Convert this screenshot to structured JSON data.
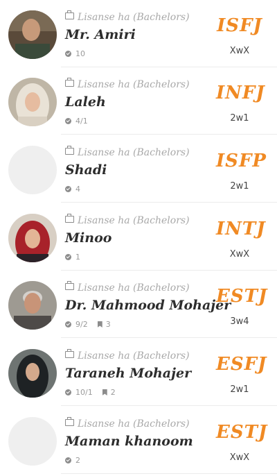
{
  "colors": {
    "accent": "#f08a24",
    "text": "#2d2d2d",
    "muted": "#a8a8a8"
  },
  "characters": [
    {
      "category": "Lisanse ha (Bachelors)",
      "name": "Mr. Amiri",
      "count": "10",
      "saves": "",
      "mbti": "ISFJ",
      "enneagram": "XwX",
      "avatar": "photo"
    },
    {
      "category": "Lisanse ha (Bachelors)",
      "name": "Laleh",
      "count": "4/1",
      "saves": "",
      "mbti": "INFJ",
      "enneagram": "2w1",
      "avatar": "photo"
    },
    {
      "category": "Lisanse ha (Bachelors)",
      "name": "Shadi",
      "count": "4",
      "saves": "",
      "mbti": "ISFP",
      "enneagram": "2w1",
      "avatar": "blank"
    },
    {
      "category": "Lisanse ha (Bachelors)",
      "name": "Minoo",
      "count": "1",
      "saves": "",
      "mbti": "INTJ",
      "enneagram": "XwX",
      "avatar": "photo"
    },
    {
      "category": "Lisanse ha (Bachelors)",
      "name": "Dr. Mahmood Mohajer",
      "count": "9/2",
      "saves": "3",
      "mbti": "ESTJ",
      "enneagram": "3w4",
      "avatar": "photo"
    },
    {
      "category": "Lisanse ha (Bachelors)",
      "name": "Taraneh Mohajer",
      "count": "10/1",
      "saves": "2",
      "mbti": "ESFJ",
      "enneagram": "2w1",
      "avatar": "photo"
    },
    {
      "category": "Lisanse ha (Bachelors)",
      "name": "Maman khanoom",
      "count": "2",
      "saves": "",
      "mbti": "ESTJ",
      "enneagram": "XwX",
      "avatar": "blank"
    }
  ]
}
